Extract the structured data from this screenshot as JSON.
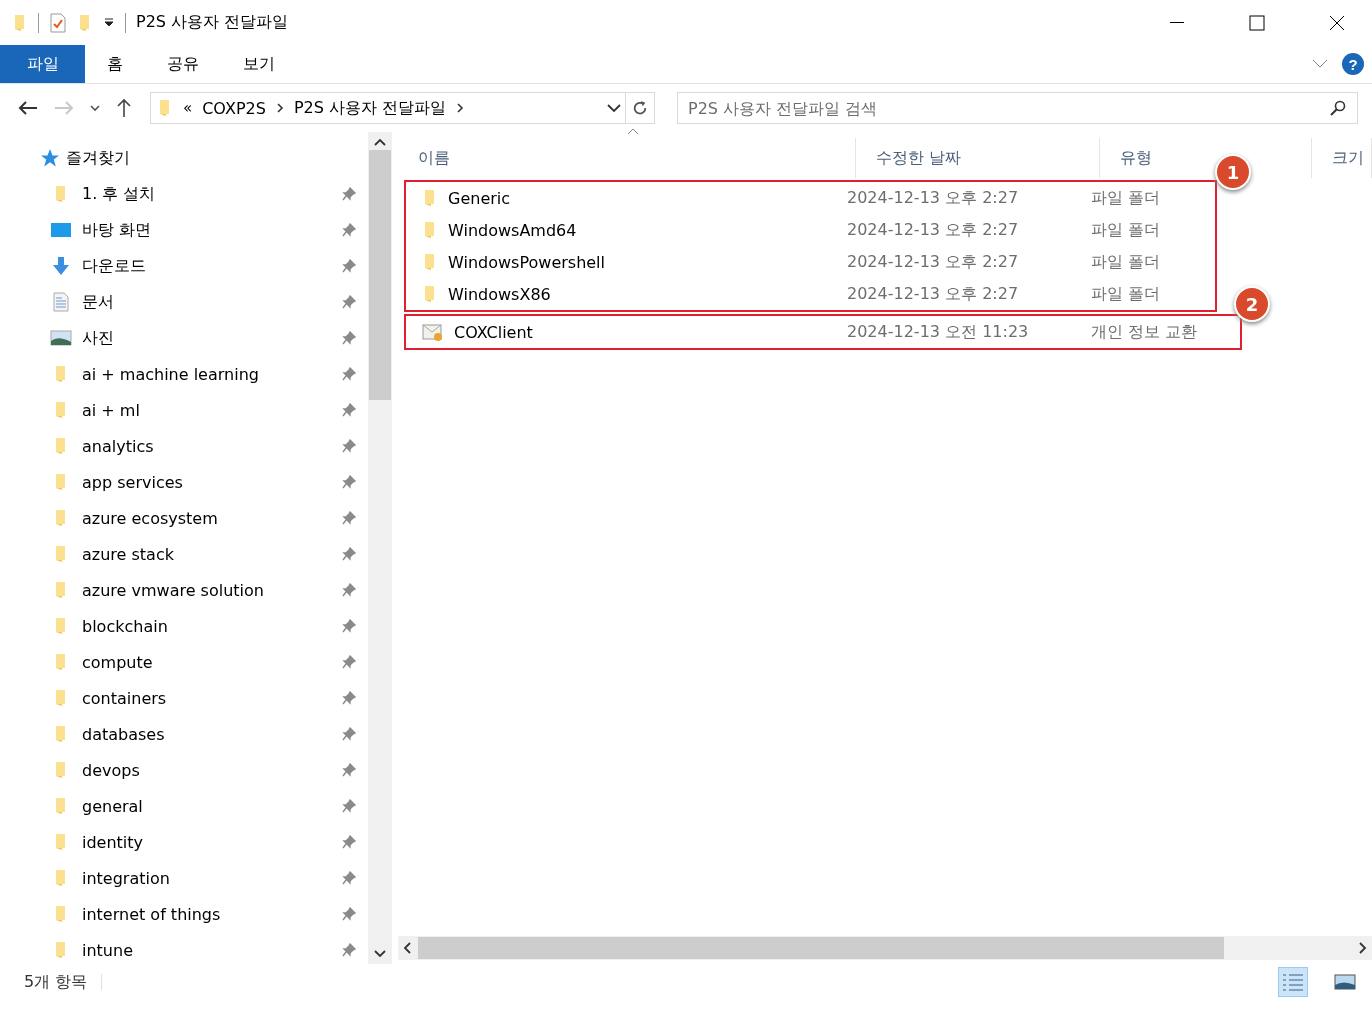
{
  "window": {
    "title": "P2S 사용자 전달파일"
  },
  "ribbon_tabs": [
    {
      "label": "파일",
      "selected": true
    },
    {
      "label": "홈",
      "selected": false
    },
    {
      "label": "공유",
      "selected": false
    },
    {
      "label": "보기",
      "selected": false
    }
  ],
  "help": "?",
  "address_bar": {
    "overflow": "«",
    "path": [
      "COXP2S",
      "P2S 사용자 전달파일"
    ]
  },
  "search": {
    "placeholder": "P2S 사용자 전달파일 검색"
  },
  "sidebar": {
    "heading": "즐겨찾기",
    "items": [
      {
        "label": "1. 후 설치",
        "kind": "folder",
        "pinned": true
      },
      {
        "label": "바탕 화면",
        "kind": "desktop",
        "pinned": true
      },
      {
        "label": "다운로드",
        "kind": "download",
        "pinned": true
      },
      {
        "label": "문서",
        "kind": "documents",
        "pinned": true
      },
      {
        "label": "사진",
        "kind": "pictures",
        "pinned": true
      },
      {
        "label": "ai + machine learning",
        "kind": "folder",
        "pinned": true
      },
      {
        "label": "ai + ml",
        "kind": "folder",
        "pinned": true
      },
      {
        "label": "analytics",
        "kind": "folder",
        "pinned": true
      },
      {
        "label": "app services",
        "kind": "folder",
        "pinned": true
      },
      {
        "label": "azure ecosystem",
        "kind": "folder",
        "pinned": true
      },
      {
        "label": "azure stack",
        "kind": "folder",
        "pinned": true
      },
      {
        "label": "azure vmware solution",
        "kind": "folder",
        "pinned": true
      },
      {
        "label": "blockchain",
        "kind": "folder",
        "pinned": true
      },
      {
        "label": "compute",
        "kind": "folder",
        "pinned": true
      },
      {
        "label": "containers",
        "kind": "folder",
        "pinned": true
      },
      {
        "label": "databases",
        "kind": "folder",
        "pinned": true
      },
      {
        "label": "devops",
        "kind": "folder",
        "pinned": true
      },
      {
        "label": "general",
        "kind": "folder",
        "pinned": true
      },
      {
        "label": "identity",
        "kind": "folder",
        "pinned": true
      },
      {
        "label": "integration",
        "kind": "folder",
        "pinned": true
      },
      {
        "label": "internet of things",
        "kind": "folder",
        "pinned": true
      },
      {
        "label": "intune",
        "kind": "folder",
        "pinned": true
      }
    ]
  },
  "file_list": {
    "columns": [
      {
        "label": "이름",
        "sorted": true
      },
      {
        "label": "수정한 날짜",
        "sorted": false
      },
      {
        "label": "유형",
        "sorted": false
      },
      {
        "label": "크기",
        "sorted": false
      }
    ],
    "groups": [
      {
        "badge": "1",
        "rows": [
          {
            "name": "Generic",
            "date": "2024-12-13 오후 2:27",
            "type": "파일 폴더",
            "kind": "folder"
          },
          {
            "name": "WindowsAmd64",
            "date": "2024-12-13 오후 2:27",
            "type": "파일 폴더",
            "kind": "folder"
          },
          {
            "name": "WindowsPowershell",
            "date": "2024-12-13 오후 2:27",
            "type": "파일 폴더",
            "kind": "folder"
          },
          {
            "name": "WindowsX86",
            "date": "2024-12-13 오후 2:27",
            "type": "파일 폴더",
            "kind": "folder"
          }
        ]
      },
      {
        "badge": "2",
        "rows": [
          {
            "name": "COXClient",
            "date": "2024-12-13 오전 11:23",
            "type": "개인 정보 교환",
            "kind": "certificate"
          }
        ]
      }
    ]
  },
  "status_bar": {
    "count": "5개 항목",
    "views": [
      {
        "kind": "details",
        "selected": true
      },
      {
        "kind": "large-icons",
        "selected": false
      }
    ]
  }
}
